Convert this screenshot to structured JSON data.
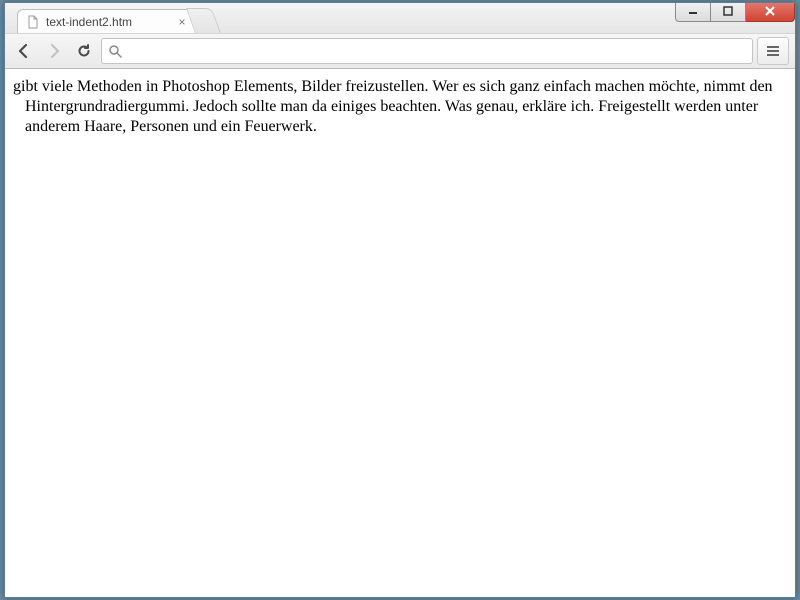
{
  "window": {
    "tab_title": "text-indent2.htm"
  },
  "toolbar": {
    "url_value": ""
  },
  "content": {
    "paragraph": "gibt viele Methoden in Photoshop Elements, Bilder freizustellen. Wer es sich ganz einfach machen möchte, nimmt den Hintergrundradiergummi. Jedoch sollte man da einiges beachten. Was genau, erkläre ich. Freigestellt werden unter anderem Haare, Personen und ein Feuerwerk."
  }
}
